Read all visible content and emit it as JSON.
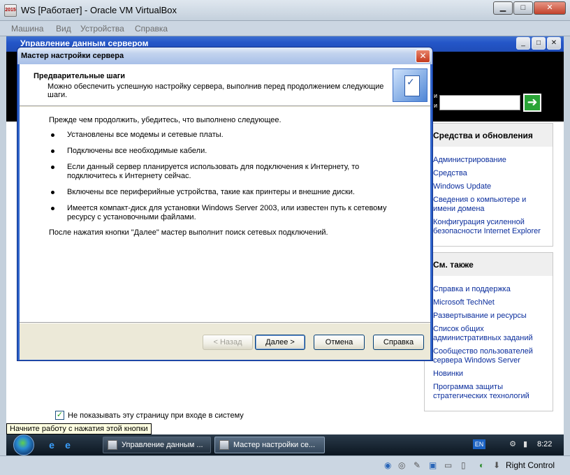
{
  "host": {
    "title": "WS [Работает] - Oracle VM VirtualBox",
    "icon_label": "2015",
    "controls": {
      "minimize": "▁",
      "maximize": "□",
      "close": "✕"
    },
    "menu": [
      "Машина",
      "Вид",
      "Устройства",
      "Справка"
    ],
    "statusbar": {
      "host_key": "Right Control"
    }
  },
  "manage_window": {
    "title": "Управление данным сервером",
    "controls": {
      "minimize": "_",
      "maximize": "□",
      "close": "✕"
    },
    "go_arrow": "➜",
    "panels": [
      {
        "title": "Средства и обновления",
        "links": [
          "Администрирование",
          "Средства",
          "Windows Update",
          "Сведения о компьютере и имени домена",
          "Конфигурация усиленной безопасности Internet Explorer"
        ]
      },
      {
        "title": "См. также",
        "links": [
          "Справка и поддержка",
          "Microsoft TechNet",
          "Развертывание и ресурсы",
          "Список общих административных заданий",
          "Сообщество пользователей сервера Windows Server",
          "Новинки",
          "Программа защиты стратегических технологий"
        ]
      }
    ],
    "dont_show_label": "Не показывать эту страницу при входе в систему",
    "dont_show_checked": true
  },
  "tooltip": "Начните работу с нажатия этой кнопки",
  "taskbar": {
    "tasks": [
      "Управление данным ...",
      "Мастер настройки се..."
    ],
    "lang": "EN",
    "clock": "8:22"
  },
  "wizard": {
    "title": "Мастер настройки сервера",
    "close": "✕",
    "header_title": "Предварительные шаги",
    "header_desc": "Можно обеспечить успешную настройку сервера, выполнив перед продолжением следующие шаги.",
    "intro": "Прежде чем продолжить, убедитесь, что выполнено следующее.",
    "items": [
      "Установлены все модемы и сетевые платы.",
      "Подключены все необходимые кабели.",
      "Если данный сервер планируется использовать для подключения к Интернету, то подключитесь к Интернету сейчас.",
      "Включены все периферийные устройства, такие как принтеры и внешние диски.",
      "Имеется компакт-диск для установки Windows Server 2003, или известен путь к сетевому ресурсу с установочными файлами."
    ],
    "after": "После нажатия кнопки \"Далее\" мастер выполнит поиск сетевых подключений.",
    "buttons": {
      "back": "< Назад",
      "next": "Далее >",
      "cancel": "Отмена",
      "help": "Справка"
    }
  }
}
